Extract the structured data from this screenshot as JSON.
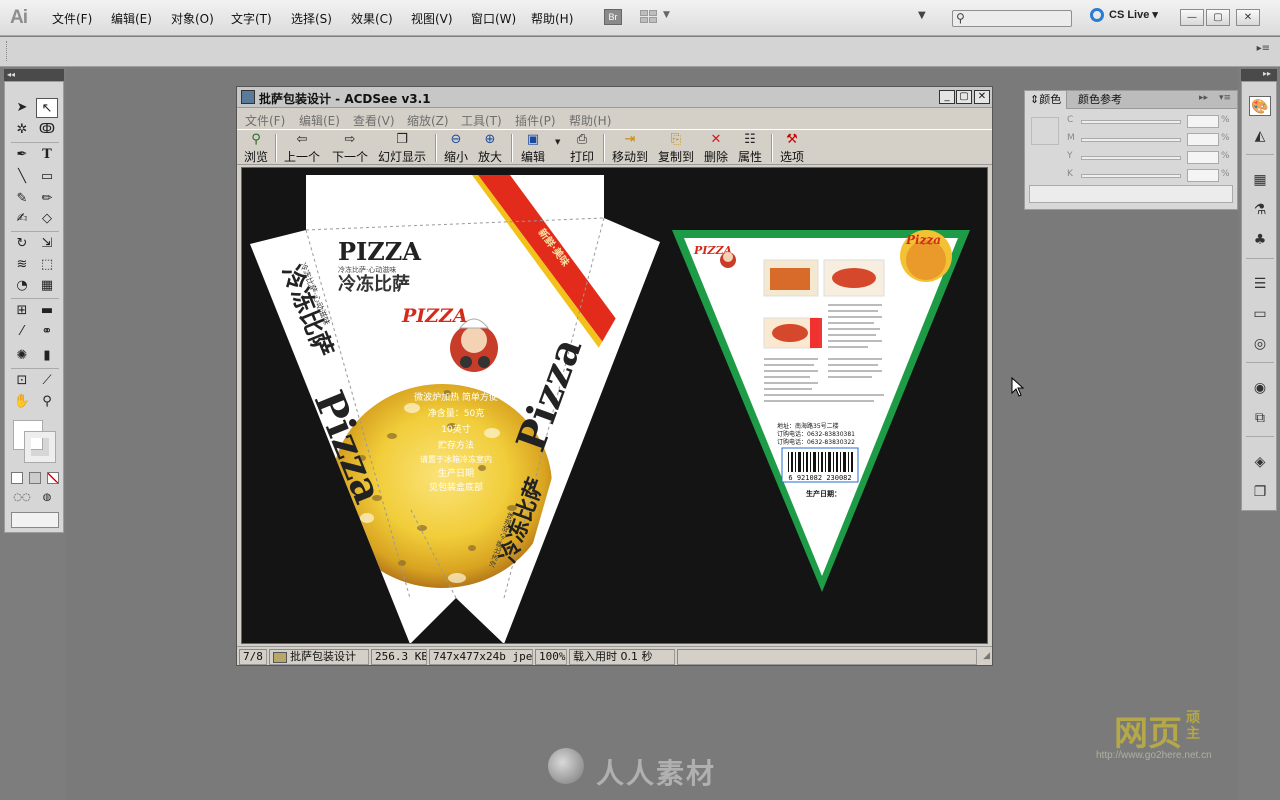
{
  "app": {
    "logo": "Ai",
    "menu": [
      "文件(F)",
      "编辑(E)",
      "对象(O)",
      "文字(T)",
      "选择(S)",
      "效果(C)",
      "视图(V)",
      "窗口(W)",
      "帮助(H)"
    ],
    "bridge_label": "Br",
    "cs_live": "CS Live",
    "search_placeholder": ""
  },
  "acdsee": {
    "title": "批萨包装设计 - ACDSee v3.1",
    "menu": [
      "文件(F)",
      "编辑(E)",
      "查看(V)",
      "缩放(Z)",
      "工具(T)",
      "插件(P)",
      "帮助(H)"
    ],
    "toolbar": [
      "浏览",
      "上一个",
      "下一个",
      "幻灯显示",
      "缩小",
      "放大",
      "编辑",
      "打印",
      "移动到",
      "复制到",
      "删除",
      "属性",
      "选项"
    ],
    "status": {
      "index": "7/8",
      "filename": "批萨包装设计",
      "size": "256.3 KB",
      "dims": "747x477x24b jpeg",
      "zoom": "100%",
      "load_time": "载入用时 0.1 秒"
    }
  },
  "artwork": {
    "brand": "PIZZA",
    "brand_alt": "Pizza",
    "product": "冷冻比萨",
    "slogan": "冷冻比萨·心动滋味",
    "ribbon": "新鲜·美味",
    "info_lines": [
      "微波炉加热  简单方便",
      "净含量：50克",
      "10英寸",
      "贮存方法",
      "请置于冰箱冷冻室内",
      "生产日期",
      "见包装盒底部"
    ],
    "back_address": "地址：南海路35号二楼",
    "back_phone1": "订购电话：0632-83830381",
    "back_phone2": "订购电话：0632-83830322",
    "barcode_number": "6 921082 230082",
    "back_date": "生产日期："
  },
  "color_panel": {
    "tabs": [
      "颜色",
      "颜色参考"
    ],
    "channels": [
      "C",
      "M",
      "Y",
      "K"
    ],
    "unit": "%"
  },
  "watermarks": {
    "center": "人人素材",
    "right_big": "网页",
    "right_small": "顽主",
    "right_url": "http://www.go2here.net.cn"
  },
  "colors": {
    "pizza_red": "#e32b1c",
    "pizza_green": "#1e9b46",
    "pizza_yellow": "#f2d23a"
  }
}
